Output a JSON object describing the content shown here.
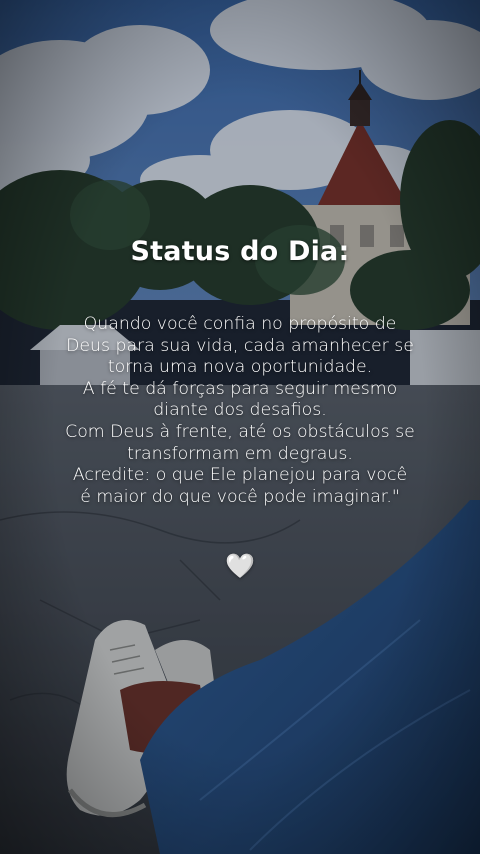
{
  "status": {
    "title": "Status do Dia:",
    "lines": [
      "Quando você confia no propósito de",
      "Deus para sua vida, cada amanhecer se",
      "torna uma nova oportunidade.",
      "A fé te dá forças para seguir mesmo",
      "diante dos desafios.",
      "Com Deus à frente, até os obstáculos se",
      "transformam em degraus.",
      "Acredite: o que Ele planejou para você",
      "é maior do que você pode imaginar.\""
    ],
    "heart": "🤍"
  },
  "colors": {
    "sky": "#3f6fb0",
    "text": "#ffffff"
  }
}
